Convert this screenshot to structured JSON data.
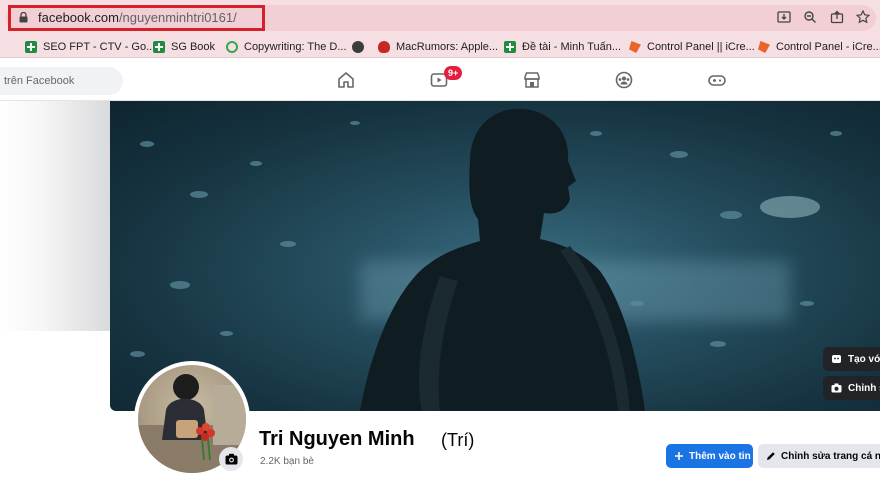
{
  "browser": {
    "url_host": "facebook.com",
    "url_path": "/nguyenminhtri0161/",
    "highlight_color": "#d6202a"
  },
  "bookmarks": [
    {
      "label": "SEO FPT - CTV - Go...",
      "icon": "sheets-icon"
    },
    {
      "label": "SG Book",
      "icon": "sheets-icon"
    },
    {
      "label": "Copywriting: The D...",
      "icon": "ring-icon"
    },
    {
      "label": "",
      "icon": "globe-icon"
    },
    {
      "label": "MacRumors: Apple...",
      "icon": "macrumors-icon"
    },
    {
      "label": "Đề tài - Minh Tuấn...",
      "icon": "sheets-icon"
    },
    {
      "label": "Control Panel || iCre...",
      "icon": "icreativ-icon"
    },
    {
      "label": "Control Panel - iCre...",
      "icon": "icreativ-icon"
    }
  ],
  "fb_header": {
    "search_placeholder": "trên Facebook",
    "video_badge": "9+"
  },
  "cover": {
    "create_btn": "Tạo vớ",
    "edit_btn": "Chỉnh sử"
  },
  "profile": {
    "name": "Tri Nguyen Minh",
    "alt_name": "(Trí)",
    "friends": "2.2K bạn bè",
    "add_story": "Thêm vào tin",
    "edit_profile": "Chỉnh sửa trang cá nhân"
  },
  "colors": {
    "fb_blue": "#1b74e4",
    "badge_red": "#e41e3f"
  }
}
